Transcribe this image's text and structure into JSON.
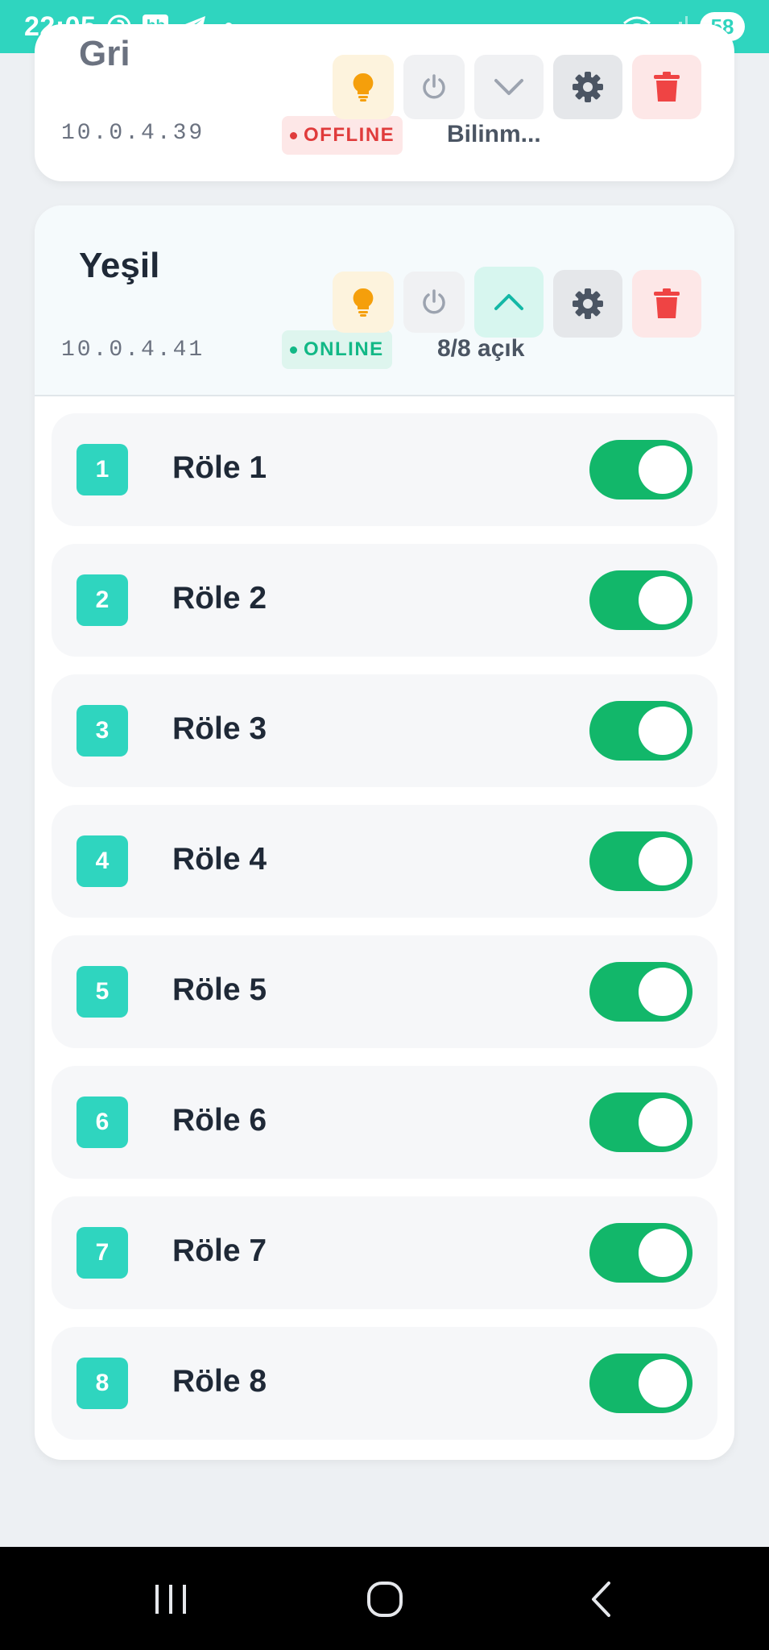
{
  "status_bar": {
    "time": "22:05",
    "hb_label": "hb",
    "battery": "58",
    "icons": [
      "pinterest-icon",
      "telegram-icon",
      "wifi-icon",
      "signal-icon"
    ]
  },
  "devices": [
    {
      "name": "Gri",
      "ip": "10.0.4.39",
      "status": "OFFLINE",
      "status_text": "Bilinm...",
      "expanded": false
    },
    {
      "name": "Yeşil",
      "ip": "10.0.4.41",
      "status": "ONLINE",
      "status_text": "8/8 açık",
      "expanded": true,
      "relays": [
        {
          "num": "1",
          "label": "Röle 1",
          "on": true
        },
        {
          "num": "2",
          "label": "Röle 2",
          "on": true
        },
        {
          "num": "3",
          "label": "Röle 3",
          "on": true
        },
        {
          "num": "4",
          "label": "Röle 4",
          "on": true
        },
        {
          "num": "5",
          "label": "Röle 5",
          "on": true
        },
        {
          "num": "6",
          "label": "Röle 6",
          "on": true
        },
        {
          "num": "7",
          "label": "Röle 7",
          "on": true
        },
        {
          "num": "8",
          "label": "Röle 8",
          "on": true
        }
      ]
    }
  ],
  "colors": {
    "accent": "#2fd5bf",
    "toggle_on": "#12b76a",
    "online": "#12b886",
    "offline": "#e03b3b",
    "bulb": "#f59f0b",
    "trash": "#ef4444"
  }
}
